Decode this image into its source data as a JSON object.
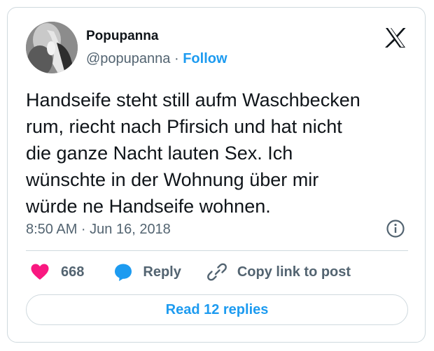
{
  "author": {
    "display_name": "Popupanna",
    "handle": "@popupanna",
    "separator": "·",
    "follow_label": "Follow"
  },
  "tweet": {
    "text": "Handseife steht still aufm Waschbecken\nrum, riecht nach Pfirsich und hat nicht\ndie ganze Nacht lauten Sex. Ich\nwünschte in der Wohnung über mir\nwürde ne Handseife wohnen.",
    "timestamp": "8:50 AM · Jun 16, 2018"
  },
  "actions": {
    "like_count": "668",
    "reply_label": "Reply",
    "copy_link_label": "Copy link to post"
  },
  "read_replies_label": "Read 12 replies",
  "icons": {
    "brand": "x-logo-icon",
    "info": "info-icon",
    "like": "heart-icon",
    "reply": "speech-bubble-icon",
    "copy": "link-icon"
  },
  "colors": {
    "accent": "#1d9bf0",
    "like": "#f91880",
    "text": "#0f1419",
    "muted": "#536471",
    "border": "#cfd9de"
  }
}
